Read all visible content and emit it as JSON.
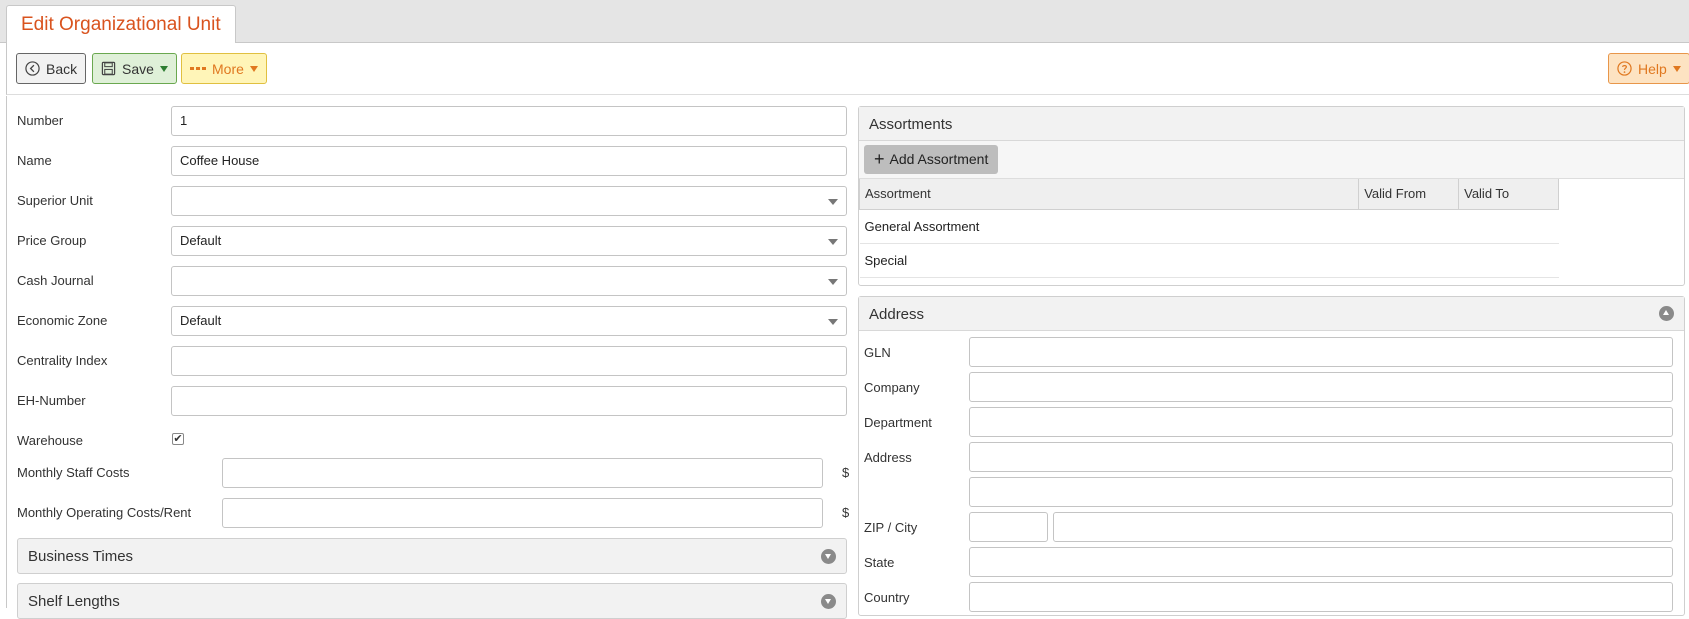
{
  "tab": {
    "title": "Edit Organizational Unit"
  },
  "toolbar": {
    "back": "Back",
    "save": "Save",
    "more": "More",
    "help": "Help"
  },
  "form": {
    "number": {
      "label": "Number",
      "value": "1"
    },
    "name": {
      "label": "Name",
      "value": "Coffee House"
    },
    "superior_unit": {
      "label": "Superior Unit",
      "value": ""
    },
    "price_group": {
      "label": "Price Group",
      "value": "Default"
    },
    "cash_journal": {
      "label": "Cash Journal",
      "value": ""
    },
    "economic_zone": {
      "label": "Economic Zone",
      "value": "Default"
    },
    "centrality_index": {
      "label": "Centrality Index",
      "value": ""
    },
    "eh_number": {
      "label": "EH-Number",
      "value": ""
    },
    "warehouse": {
      "label": "Warehouse",
      "checked": true,
      "mark": "✔"
    },
    "monthly_staff_costs": {
      "label": "Monthly Staff Costs",
      "value": "",
      "unit": "$"
    },
    "monthly_operating": {
      "label": "Monthly Operating Costs/Rent",
      "value": "",
      "unit": "$"
    }
  },
  "sections": {
    "business_times": "Business Times",
    "shelf_lengths": "Shelf Lengths"
  },
  "assortments": {
    "title": "Assortments",
    "add_label": "Add Assortment",
    "plus": "+",
    "columns": [
      "Assortment",
      "Valid From",
      "Valid To"
    ],
    "rows": [
      {
        "assortment": "General Assortment",
        "valid_from": "",
        "valid_to": ""
      },
      {
        "assortment": "Special",
        "valid_from": "",
        "valid_to": ""
      }
    ]
  },
  "address": {
    "title": "Address",
    "gln": "GLN",
    "company": "Company",
    "department": "Department",
    "address": "Address",
    "zip_city": "ZIP / City",
    "state": "State",
    "country": "Country"
  }
}
